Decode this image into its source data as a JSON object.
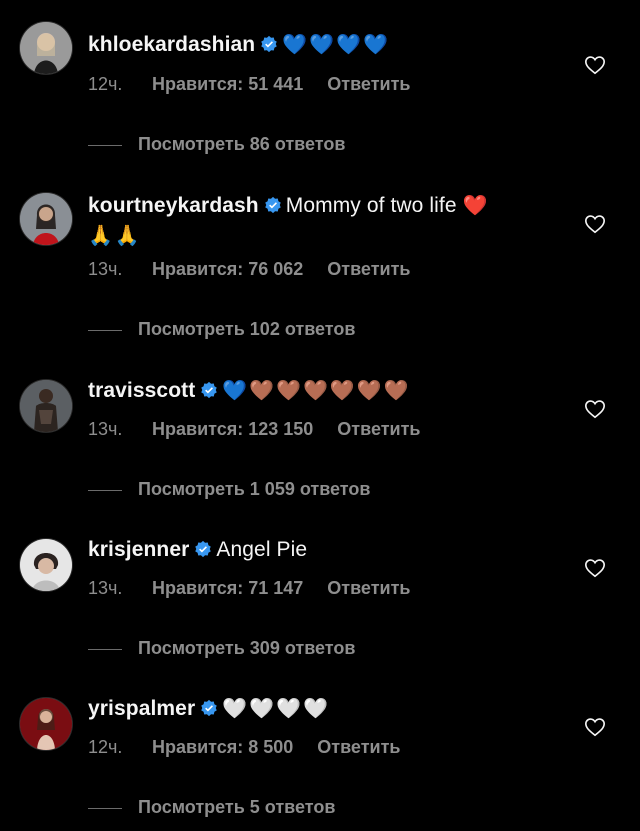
{
  "comments": [
    {
      "username": "khloekardashian",
      "text": "",
      "emoji": "💙💙💙💙",
      "time": "12ч.",
      "likes": "Нравится: 51 441",
      "reply": "Ответить",
      "replies": "Посмотреть 86 ответов"
    },
    {
      "username": "kourtneykardash",
      "text": "Mommy of two life",
      "emoji": "❤️",
      "emoji2": "🙏🙏",
      "time": "13ч.",
      "likes": "Нравится: 76 062",
      "reply": "Ответить",
      "replies": "Посмотреть 102 ответов"
    },
    {
      "username": "travisscott",
      "text": "",
      "emoji": "💙🤎🤎🤎🤎🤎🤎",
      "time": "13ч.",
      "likes": "Нравится: 123 150",
      "reply": "Ответить",
      "replies": "Посмотреть 1 059 ответов"
    },
    {
      "username": "krisjenner",
      "text": "Angel Pie",
      "emoji": "",
      "time": "13ч.",
      "likes": "Нравится: 71 147",
      "reply": "Ответить",
      "replies": "Посмотреть 309 ответов"
    },
    {
      "username": "yrispalmer",
      "text": "",
      "emoji": "🤍🤍🤍🤍",
      "time": "12ч.",
      "likes": "Нравится: 8 500",
      "reply": "Ответить",
      "replies": "Посмотреть 5 ответов"
    }
  ],
  "colors": {
    "background": "#000000",
    "text": "#f5f5f5",
    "muted": "#8e8e8e",
    "verified": "#3897f0"
  },
  "icons": {
    "verified": "verified-badge-icon",
    "like": "heart-outline-icon"
  }
}
